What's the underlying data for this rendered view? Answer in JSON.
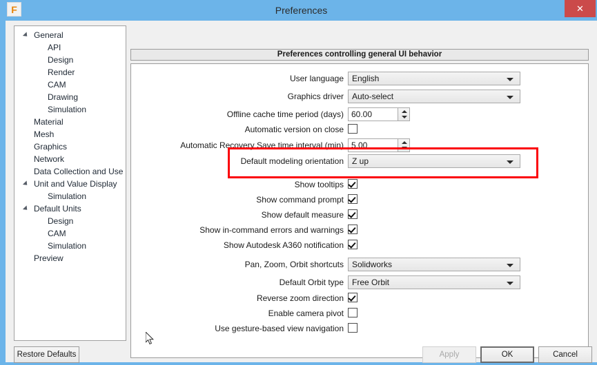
{
  "window": {
    "title": "Preferences",
    "app_icon_letter": "F",
    "close_label": "✕",
    "titlebar_color": "#6cb4e9",
    "close_button_color": "#cb4a4a"
  },
  "sidebar": {
    "items": [
      {
        "label": "General",
        "level": 0,
        "expandable": true
      },
      {
        "label": "API",
        "level": 1,
        "expandable": false
      },
      {
        "label": "Design",
        "level": 1,
        "expandable": false
      },
      {
        "label": "Render",
        "level": 1,
        "expandable": false
      },
      {
        "label": "CAM",
        "level": 1,
        "expandable": false
      },
      {
        "label": "Drawing",
        "level": 1,
        "expandable": false
      },
      {
        "label": "Simulation",
        "level": 1,
        "expandable": false
      },
      {
        "label": "Material",
        "level": 0,
        "expandable": false
      },
      {
        "label": "Mesh",
        "level": 0,
        "expandable": false
      },
      {
        "label": "Graphics",
        "level": 0,
        "expandable": false
      },
      {
        "label": "Network",
        "level": 0,
        "expandable": false
      },
      {
        "label": "Data Collection and Use",
        "level": 0,
        "expandable": false
      },
      {
        "label": "Unit and Value Display",
        "level": 0,
        "expandable": true
      },
      {
        "label": "Simulation",
        "level": 1,
        "expandable": false
      },
      {
        "label": "Default Units",
        "level": 0,
        "expandable": true
      },
      {
        "label": "Design",
        "level": 1,
        "expandable": false
      },
      {
        "label": "CAM",
        "level": 1,
        "expandable": false
      },
      {
        "label": "Simulation",
        "level": 1,
        "expandable": false
      },
      {
        "label": "Preview",
        "level": 0,
        "expandable": false
      }
    ]
  },
  "main": {
    "header": "Preferences controlling general UI behavior",
    "rows": [
      {
        "label": "User language",
        "type": "combo",
        "value": "English"
      },
      {
        "label": "Graphics driver",
        "type": "combo",
        "value": "Auto-select"
      },
      {
        "label": "Offline cache time period (days)",
        "type": "spin",
        "value": "60.00"
      },
      {
        "label": "Automatic version on close",
        "type": "check",
        "value": false
      },
      {
        "label": "Automatic Recovery Save time interval (min)",
        "type": "spin",
        "value": "5.00"
      },
      {
        "label": "Default modeling orientation",
        "type": "combo",
        "value": "Z up"
      },
      {
        "label": "Show tooltips",
        "type": "check",
        "value": true
      },
      {
        "label": "Show command prompt",
        "type": "check",
        "value": true
      },
      {
        "label": "Show default measure",
        "type": "check",
        "value": true
      },
      {
        "label": "Show in-command errors and warnings",
        "type": "check",
        "value": true
      },
      {
        "label": "Show Autodesk A360 notification",
        "type": "check",
        "value": true
      },
      {
        "label": "Pan, Zoom, Orbit shortcuts",
        "type": "combo",
        "value": "Solidworks"
      },
      {
        "label": "Default Orbit type",
        "type": "combo",
        "value": "Free Orbit"
      },
      {
        "label": "Reverse zoom direction",
        "type": "check",
        "value": true
      },
      {
        "label": "Enable camera pivot",
        "type": "check",
        "value": false
      },
      {
        "label": "Use gesture-based view navigation",
        "type": "check",
        "value": false
      }
    ]
  },
  "annotation": {
    "highlight_color": "#fb0007",
    "highlights_row_label": "Default modeling orientation"
  },
  "footer": {
    "restore_defaults": "Restore Defaults",
    "apply": "Apply",
    "apply_enabled": false,
    "ok": "OK",
    "cancel": "Cancel"
  }
}
